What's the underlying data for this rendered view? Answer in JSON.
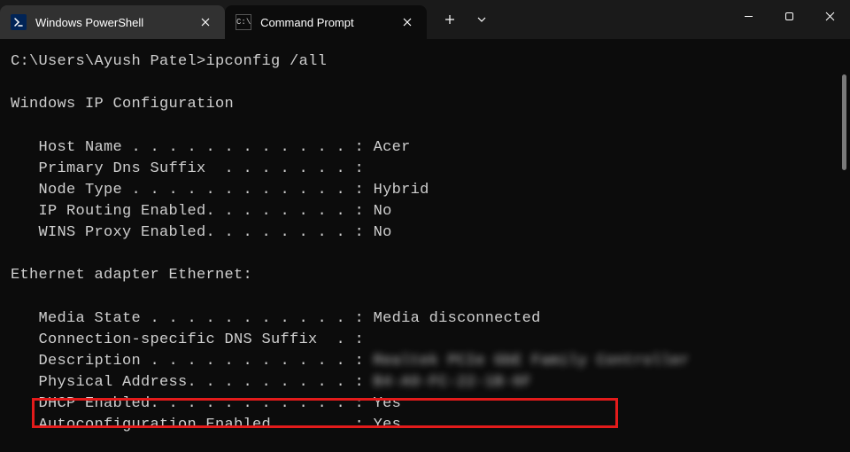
{
  "tabs": [
    {
      "label": "Windows PowerShell",
      "icon": "powershell-icon",
      "active": true
    },
    {
      "label": "Command Prompt",
      "icon": "cmd-icon",
      "active": false
    }
  ],
  "terminal": {
    "prompt": "C:\\Users\\Ayush Patel>",
    "command": "ipconfig /all",
    "section1_title": "Windows IP Configuration",
    "host_name_label": "   Host Name . . . . . . . . . . . . : ",
    "host_name_value": "Acer",
    "primary_dns_label": "   Primary Dns Suffix  . . . . . . . :",
    "node_type_label": "   Node Type . . . . . . . . . . . . : ",
    "node_type_value": "Hybrid",
    "ip_routing_label": "   IP Routing Enabled. . . . . . . . : ",
    "ip_routing_value": "No",
    "wins_proxy_label": "   WINS Proxy Enabled. . . . . . . . : ",
    "wins_proxy_value": "No",
    "section2_title": "Ethernet adapter Ethernet:",
    "media_state_label": "   Media State . . . . . . . . . . . : ",
    "media_state_value": "Media disconnected",
    "conn_dns_label": "   Connection-specific DNS Suffix  . :",
    "description_label": "   Description . . . . . . . . . . . : ",
    "description_value": "Realtek PCIe GbE Family Controller",
    "physical_addr_label": "   Physical Address. . . . . . . . . : ",
    "physical_addr_value": "B4-A9-FC-22-1B-6F",
    "dhcp_label": "   DHCP Enabled. . . . . . . . . . . : ",
    "dhcp_value": "Yes",
    "autoconfig_label": "   Autoconfiguration Enabled . . . . : ",
    "autoconfig_value": "Yes"
  },
  "highlight_color": "#e31b1b"
}
